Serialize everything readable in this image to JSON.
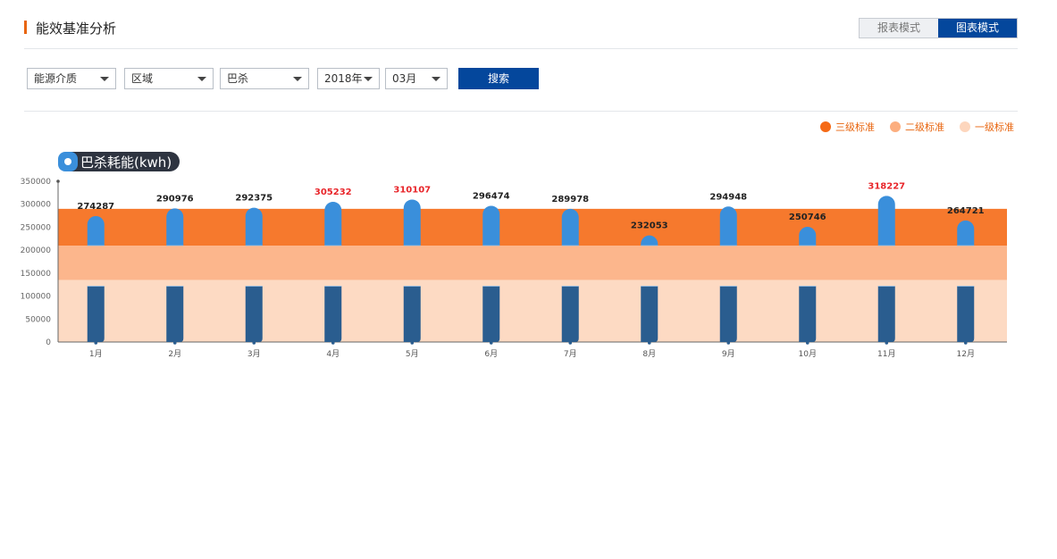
{
  "header": {
    "title": "能效基准分析",
    "mode_table": "报表模式",
    "mode_chart": "图表模式"
  },
  "filters": {
    "energy_type": "能源介质",
    "region": "区域",
    "area": "巴杀",
    "year": "2018年",
    "month": "03月",
    "search_label": "搜索"
  },
  "colors": {
    "accent": "#e8650f",
    "primary": "#04479c",
    "level3": "#f56a16",
    "level2": "#fcae7f",
    "level1": "#fdd6bd",
    "bar_top": "#3a8fdb",
    "bar_mid": "#2f78b8",
    "bar_bottom": "#2a5d8f",
    "over_label": "#e8252a"
  },
  "chart_data": {
    "type": "bar",
    "title": "巴杀耗能(kwh)",
    "categories": [
      "1月",
      "2月",
      "3月",
      "4月",
      "5月",
      "6月",
      "7月",
      "8月",
      "9月",
      "10月",
      "11月",
      "12月"
    ],
    "values": [
      274287,
      290976,
      292375,
      305232,
      310107,
      296474,
      289978,
      232053,
      294948,
      250746,
      318227,
      264721
    ],
    "highlighted": [
      false,
      false,
      false,
      true,
      true,
      false,
      false,
      false,
      false,
      false,
      true,
      false
    ],
    "ylim": [
      0,
      350000
    ],
    "yticks": [
      "0",
      "50000",
      "100000",
      "150000",
      "200000",
      "250000",
      "300000",
      "350000"
    ],
    "standards": [
      {
        "name": "三级标准",
        "value": 290000
      },
      {
        "name": "二级标准",
        "value": 210000
      },
      {
        "name": "一级标准",
        "value": 135000
      }
    ],
    "legend_placement": "top-right",
    "grid": false
  }
}
